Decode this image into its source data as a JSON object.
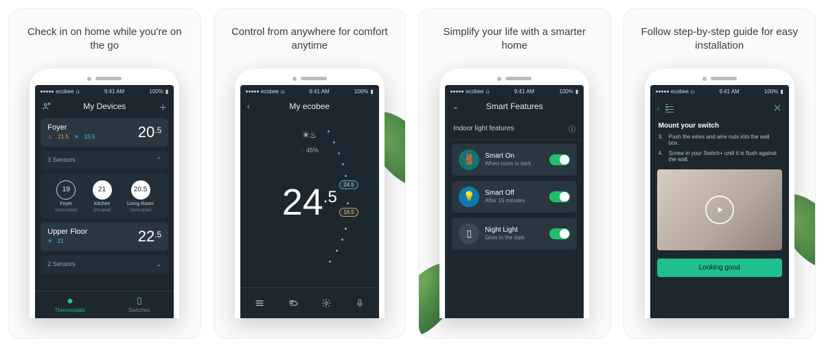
{
  "status": {
    "carrier": "ecobee",
    "time": "9:41 AM",
    "battery": "100%"
  },
  "captions": [
    "Check in on home while you're on the go",
    "Control from anywhere for comfort anytime",
    "Simplify your life with a smarter home",
    "Follow step-by-step guide for easy installation"
  ],
  "card1": {
    "title": "My Devices",
    "foyer": {
      "name": "Foyer",
      "heat": "21.5",
      "cool": "23.5",
      "temp_int": "20",
      "temp_dec": ".5"
    },
    "sensors_label": "3 Sensors",
    "sensors": [
      {
        "temp": "19",
        "name": "Foyer",
        "occ": "Unoccupied",
        "filled": false
      },
      {
        "temp": "21",
        "name": "Kitchen",
        "occ": "Occupied",
        "filled": true
      },
      {
        "temp": "20.5",
        "name": "Living Room",
        "occ": "Unoccupied",
        "filled": true
      }
    ],
    "upper": {
      "name": "Upper Floor",
      "cool": "21",
      "temp_int": "22",
      "temp_dec": ".5"
    },
    "sensors2_label": "2 Sensors",
    "tabs": {
      "thermostats": "Thermostats",
      "switches": "Switches"
    }
  },
  "card2": {
    "title": "My ecobee",
    "humidity": "45%",
    "temp_int": "24",
    "temp_dec": ".5",
    "setpoint_high": "24.5",
    "setpoint_low": "18.5"
  },
  "card3": {
    "title": "Smart Features",
    "section": "Indoor light features",
    "features": [
      {
        "name": "Smart On",
        "sub": "When room is dark"
      },
      {
        "name": "Smart Off",
        "sub": "After 15 minutes"
      },
      {
        "name": "Night Light",
        "sub": "Glow in the dark"
      }
    ]
  },
  "card4": {
    "title": "Mount your switch",
    "steps": [
      {
        "n": "3.",
        "t": "Push the wires and wire nuts into the wall box."
      },
      {
        "n": "4.",
        "t": "Screw in your Switch+ until it is flush against the wall."
      }
    ],
    "cta": "Looking good"
  }
}
